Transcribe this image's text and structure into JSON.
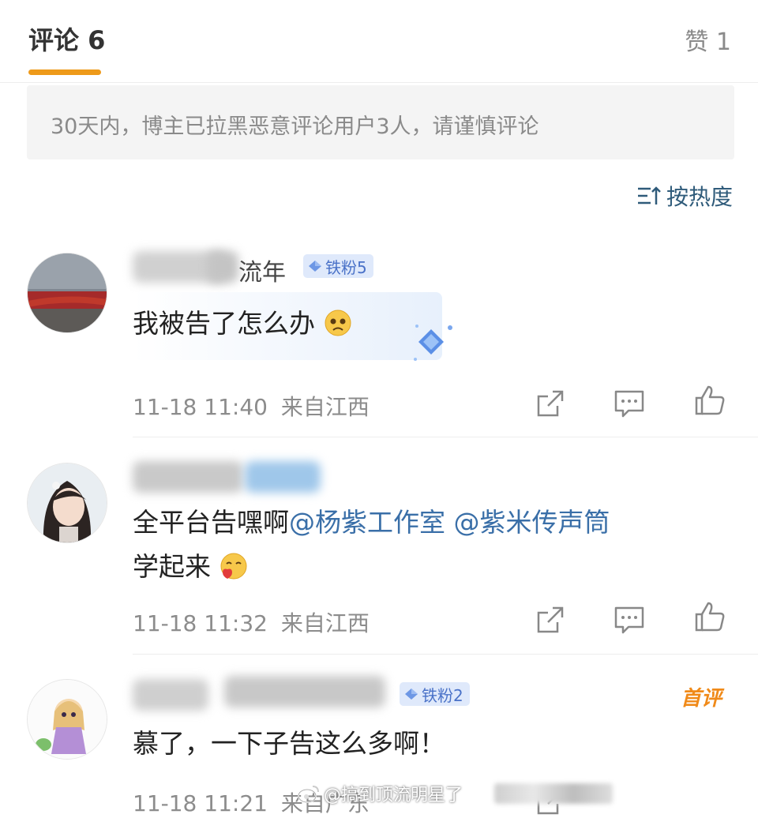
{
  "header": {
    "tab_comments": "评论 6",
    "tab_likes": "赞 1"
  },
  "notice": "30天内，博主已拉黑恶意评论用户3人，请谨慎评论",
  "sort_label": "按热度",
  "comments": [
    {
      "name_suffix": "流年",
      "badge": "铁粉5",
      "text": "我被告了怎么办",
      "time": "11-18 11:40",
      "location": "来自江西"
    },
    {
      "text_plain": "全平台告嘿啊",
      "mention1": "@杨紫工作室",
      "mention2": "@紫米传声筒",
      "text_line2": "学起来",
      "time": "11-18 11:32",
      "location": "来自江西"
    },
    {
      "badge": "铁粉2",
      "first_tag": "首评",
      "text": "慕了，一下子告这么多啊！",
      "time": "11-18 11:21",
      "location": "来自广东"
    }
  ],
  "watermark": "@搞到顶流明星了",
  "colors": {
    "accent": "#ee9a1a",
    "mention": "#3a6fa8",
    "badge_bg": "#dfe9fb",
    "badge_text": "#4a72c8",
    "first_tag": "#f08a19"
  },
  "icons": [
    "sort-icon",
    "share-icon",
    "comment-icon",
    "like-icon",
    "diamond-icon",
    "emoji-icon",
    "weibo-icon"
  ]
}
